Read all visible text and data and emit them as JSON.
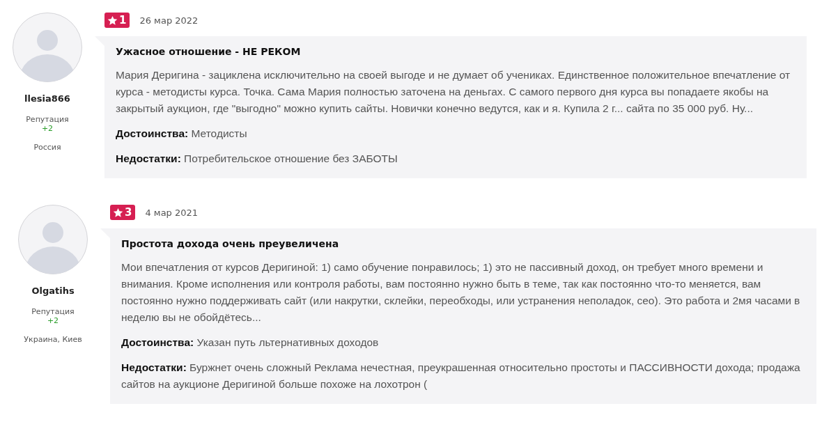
{
  "reviews": [
    {
      "author": {
        "name": "llesia866",
        "reputation_label": "Репутация",
        "reputation": "+2",
        "location": "Россия"
      },
      "rating": "1",
      "date": "26 мар 2022",
      "title": "Ужасное отношение - НЕ РЕКОМ",
      "text": "Мария Деригина - зациклена исключительно на своей выгоде и не думает об учениках. Единственное положительное впечатление от курса - методисты курса. Точка. Сама Мария полностью заточена на деньгах. С самого первого дня курса вы попадаете якобы на закрытый аукцион, где \"выгодно\" можно купить сайты. Новички конечно ведутся, как и я. Купила 2 г... сайта по 35 000 руб. Ну...",
      "pros": "**Достоинства:** Методисты",
      "cons": "**Недостатки:** Потребительское отношение без ЗАБОТЫ"
    },
    {
      "author": {
        "name": "Olgatihs",
        "reputation_label": "Репутация",
        "reputation": "+2",
        "location": "Украина, Киев"
      },
      "rating": "3",
      "date": "4 мар 2021",
      "title": "Простота дохода очень преувеличена",
      "text": "Мои впечатления от курсов Деригиной: 1) само обучение понравилось; 1) это не пассивный доход, он требует много времени и внимания. Кроме исполнения или контроля работы, вам постоянно нужно быть в теме, так как постоянно что-то меняется, вам постоянно нужно поддерживать сайт (или накрутки, склейки, переобходы, или устранения неполадок, сео). Это работа и 2мя часами в неделю вы не обойдётесь...",
      "pros": "**Достоинства:** Указан путь льтернативных доходов",
      "cons": "**Недостатки:** Буржнет очень сложный Реклама нечестная, преукрашенная относительно простоты и ПАССИВНОСТИ дохода; продажа сайтов на аукционе Деригиной больше похоже на лохотрон ("
    }
  ]
}
